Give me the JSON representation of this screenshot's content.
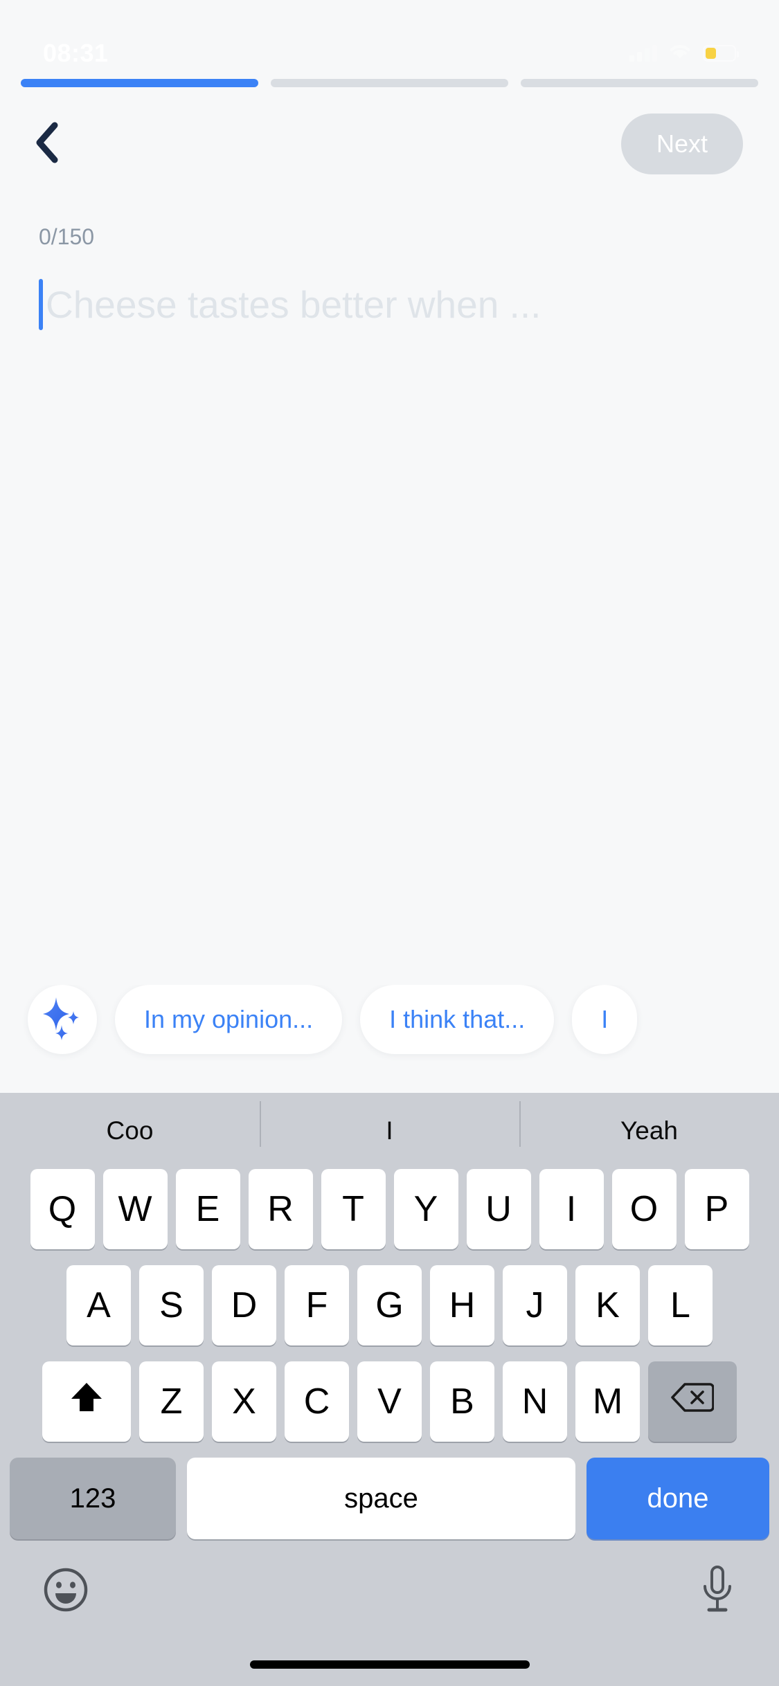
{
  "status_bar": {
    "time": "08:31",
    "signal_icon": "cellular-signal-icon",
    "wifi_icon": "wifi-icon",
    "battery_icon": "battery-icon",
    "battery_color": "#f8d244"
  },
  "progress": {
    "segments": [
      {
        "label": "step-1",
        "active": true
      },
      {
        "label": "step-2",
        "active": false
      },
      {
        "label": "step-3",
        "active": false
      }
    ],
    "active_color": "#3b82f6",
    "inactive_color": "#d9dde2"
  },
  "nav": {
    "back_icon": "chevron-left-icon",
    "next_label": "Next",
    "next_disabled": true
  },
  "compose": {
    "char_counter": "0/150",
    "value": "",
    "placeholder": "Cheese tastes better when ...",
    "caret_color": "#3b82f6"
  },
  "suggestions": {
    "ai_icon": "sparkles-icon",
    "chips": [
      {
        "label": "In my opinion..."
      },
      {
        "label": "I think that..."
      },
      {
        "label": "I"
      }
    ],
    "chip_text_color": "#3b82f6"
  },
  "keyboard": {
    "predictions": [
      "Coo",
      "I",
      "Yeah"
    ],
    "row1": [
      "Q",
      "W",
      "E",
      "R",
      "T",
      "Y",
      "U",
      "I",
      "O",
      "P"
    ],
    "row2": [
      "A",
      "S",
      "D",
      "F",
      "G",
      "H",
      "J",
      "K",
      "L"
    ],
    "row3": [
      "Z",
      "X",
      "C",
      "V",
      "B",
      "N",
      "M"
    ],
    "shift_icon": "shift-up-arrow-icon",
    "backspace_icon": "backspace-delete-icon",
    "numbers_label": "123",
    "space_label": "space",
    "done_label": "done",
    "done_color": "#3b7ff0",
    "emoji_icon": "emoji-smiley-icon",
    "dictation_icon": "microphone-icon"
  },
  "home_indicator": "home-indicator-bar"
}
